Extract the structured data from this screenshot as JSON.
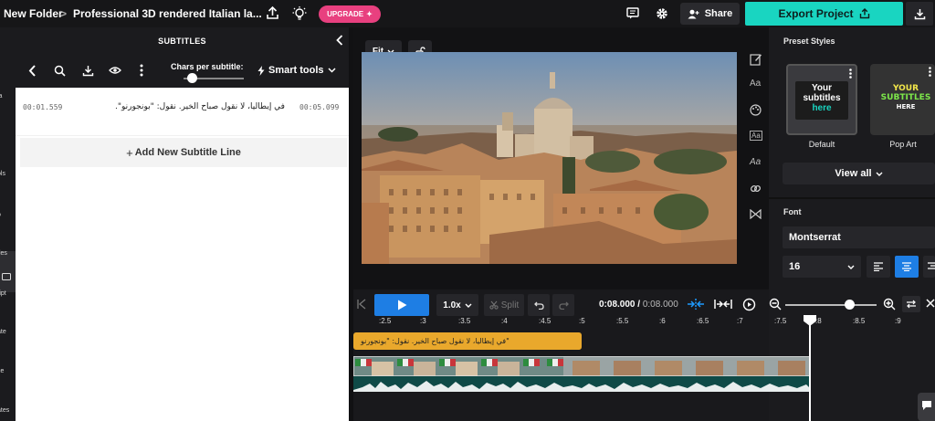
{
  "topbar": {
    "folder": "New Folder",
    "breadcrumb_sep": ">",
    "project_title": "Professional 3D rendered Italian la...",
    "upgrade_label": "UPGRADE",
    "share_label": "Share",
    "export_label": "Export Project"
  },
  "left_rail": {
    "items": [
      "ia",
      "t",
      "ols",
      "o",
      "tles",
      "ript",
      "ate",
      "ce",
      "ates"
    ]
  },
  "subtitles": {
    "header": "SUBTITLES",
    "chars_label": "Chars per subtitle:",
    "chars_level": 0.14,
    "smart_tools_label": "Smart tools",
    "rows": [
      {
        "start": "00:01.559",
        "end": "00:05.099",
        "text": "في إيطاليا، لا نقول صباح الخير. نقول: \"بونجورنو\"."
      }
    ],
    "add_line_label": "Add New Subtitle Line",
    "add_line_icon": "+"
  },
  "preview": {
    "fit_label": "Fit"
  },
  "side_tools": [
    "edit-icon",
    "Aa",
    "palette-icon",
    "Aa",
    "Aa",
    "link-icon",
    "bowtie-icon"
  ],
  "right_panel": {
    "preset_heading": "Preset Styles",
    "presets": [
      {
        "label": "Default",
        "preview_text": "Your subtitles here"
      },
      {
        "label": "Pop Art",
        "preview_text": "YOUR SUBTITLES HERE"
      }
    ],
    "view_all_label": "View all",
    "font_heading": "Font",
    "font_value": "Montserrat",
    "font_size": "16"
  },
  "timeline": {
    "speed": "1.0x",
    "split_label": "Split",
    "current_time": "0:08.000",
    "separator": " / ",
    "total_time": "0:08.000",
    "ruler": [
      ":2.5",
      ":3",
      ":3.5",
      ":4",
      ":4.5",
      ":5",
      ":5.5",
      ":6",
      ":6.5",
      ":7",
      ":7.5",
      ":8",
      ":8.5",
      ":9"
    ],
    "subtitle_clip_text": "\"في إيطاليا، لا نقول صباح الخير. نقول: \"بونجورنو",
    "zoom_level": 0.7
  },
  "colors": {
    "accent_teal": "#19d5c1",
    "upgrade_pink": "#e8407f",
    "play_blue": "#1e7ee4",
    "subtitle_clip": "#e9a82c"
  }
}
